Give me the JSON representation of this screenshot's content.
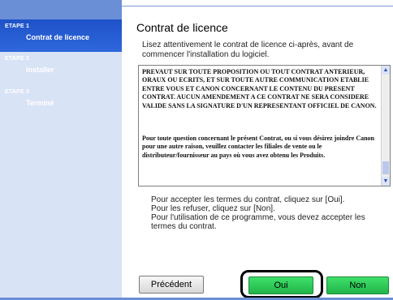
{
  "sidebar": {
    "steps": [
      {
        "label": "ETAPE 1",
        "name": "Contrat de licence",
        "active": true
      },
      {
        "label": "ETAPE 2",
        "name": "Installer",
        "active": false
      },
      {
        "label": "ETAPE 3",
        "name": "Terminé",
        "active": false
      }
    ]
  },
  "main": {
    "title": "Contrat de licence",
    "subtitle": "Lisez attentivement le contrat de licence ci-après, avant de commencer l'installation du logiciel.",
    "license": {
      "paragraph1": "PREVAUT SUR TOUTE PROPOSITION OU TOUT CONTRAT ANTERIEUR, ORAUX OU ECRITS, ET SUR TOUTE AUTRE COMMUNICATION ETABLIE ENTRE VOUS ET CANON CONCERNANT LE CONTENU DU PRESENT CONTRAT. AUCUN AMENDEMENT A CE CONTRAT NE SERA CONSIDERE VALIDE SANS LA SIGNATURE D'UN REPRESENTANT OFFICIEL DE CANON.",
      "paragraph2": "Pour toute question concernant le présent Contrat, ou si vous désirez joindre Canon pour une autre raison, veuillez contacter les filiales de vente ou le distributeur/fournisseur au pays où vous avez obtenu les Produits."
    },
    "info": {
      "line1": "Pour accepter les termes du contrat, cliquez sur [Oui].",
      "line2": "Pour les refuser, cliquez sur [Non].",
      "line3": "Pour l'utilisation de ce programme, vous devez accepter les termes du contrat."
    }
  },
  "buttons": {
    "previous": "Précédent",
    "yes": "Oui",
    "no": "Non"
  },
  "colors": {
    "sidebar_bg": "#d9e3f6",
    "active_step": "#1e52c8",
    "accent": "#6b8fd6",
    "button_green": "#22b44a"
  }
}
